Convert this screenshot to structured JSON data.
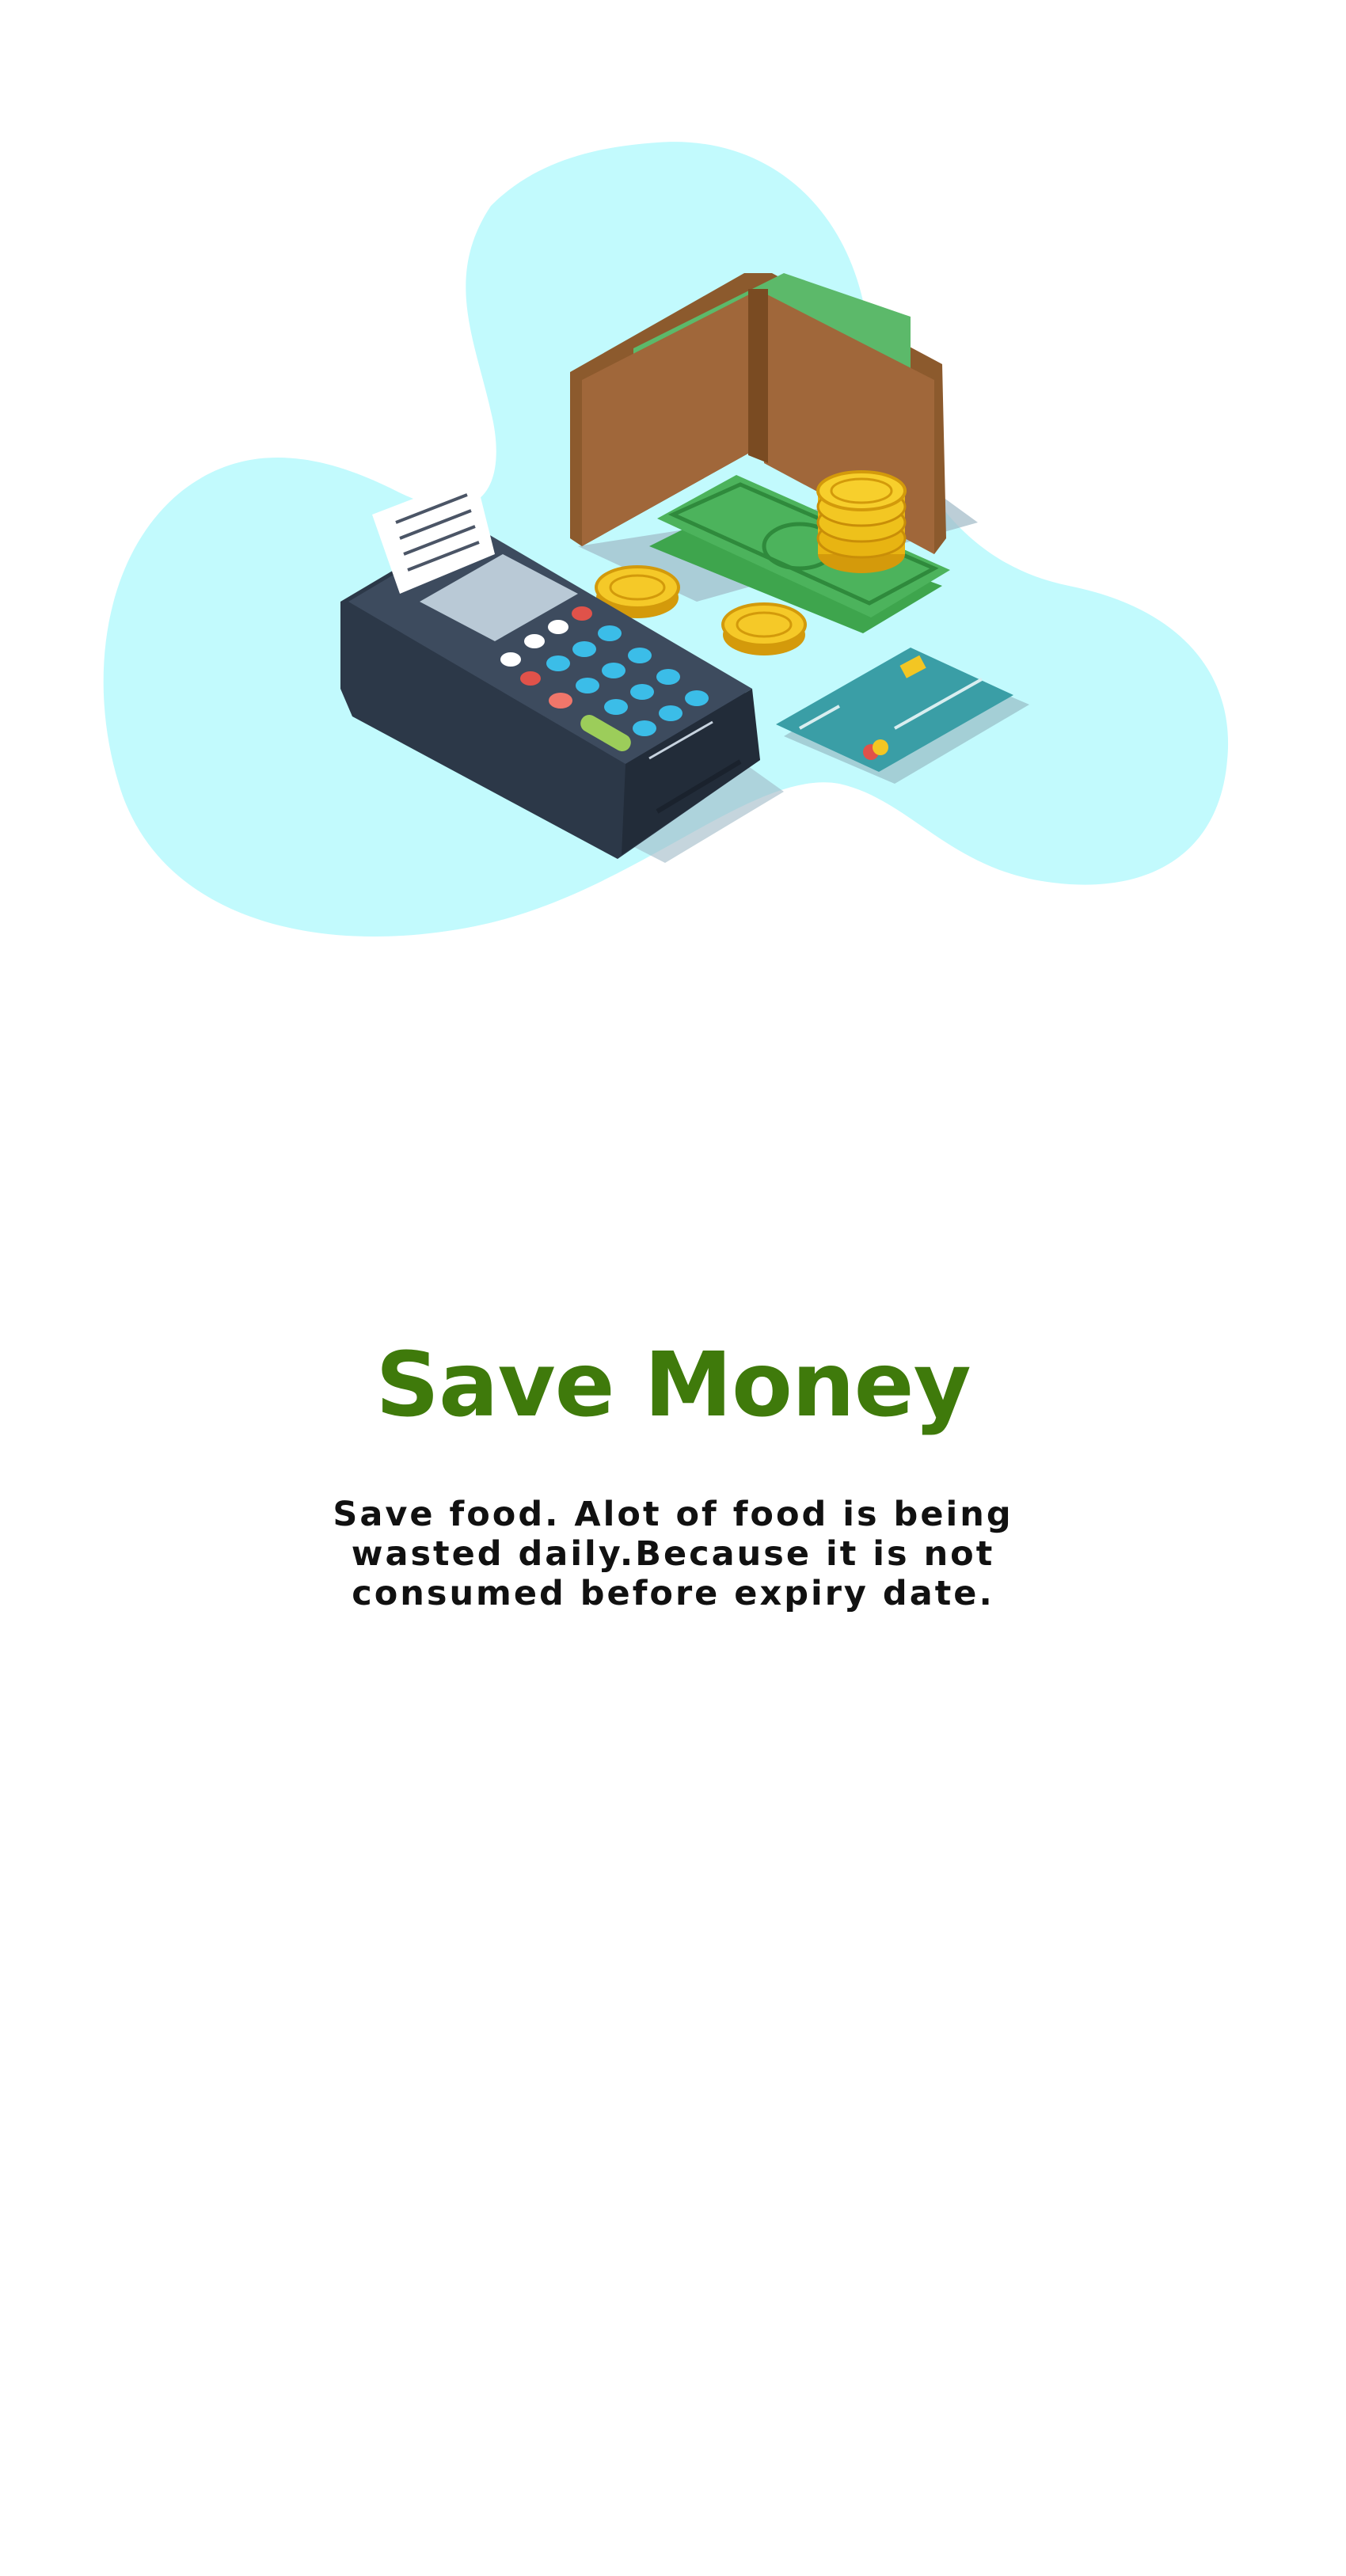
{
  "onboarding": {
    "illustration_icon": "wallet-pos-terminal-illustration",
    "title": "Save Money",
    "description": "Save food. Alot of food is being wasted daily.Because it is not consumed before expiry date."
  },
  "colors": {
    "title": "#3f7a0b",
    "description": "#111111",
    "blob": "#c2fafd",
    "background": "#ffffff"
  }
}
